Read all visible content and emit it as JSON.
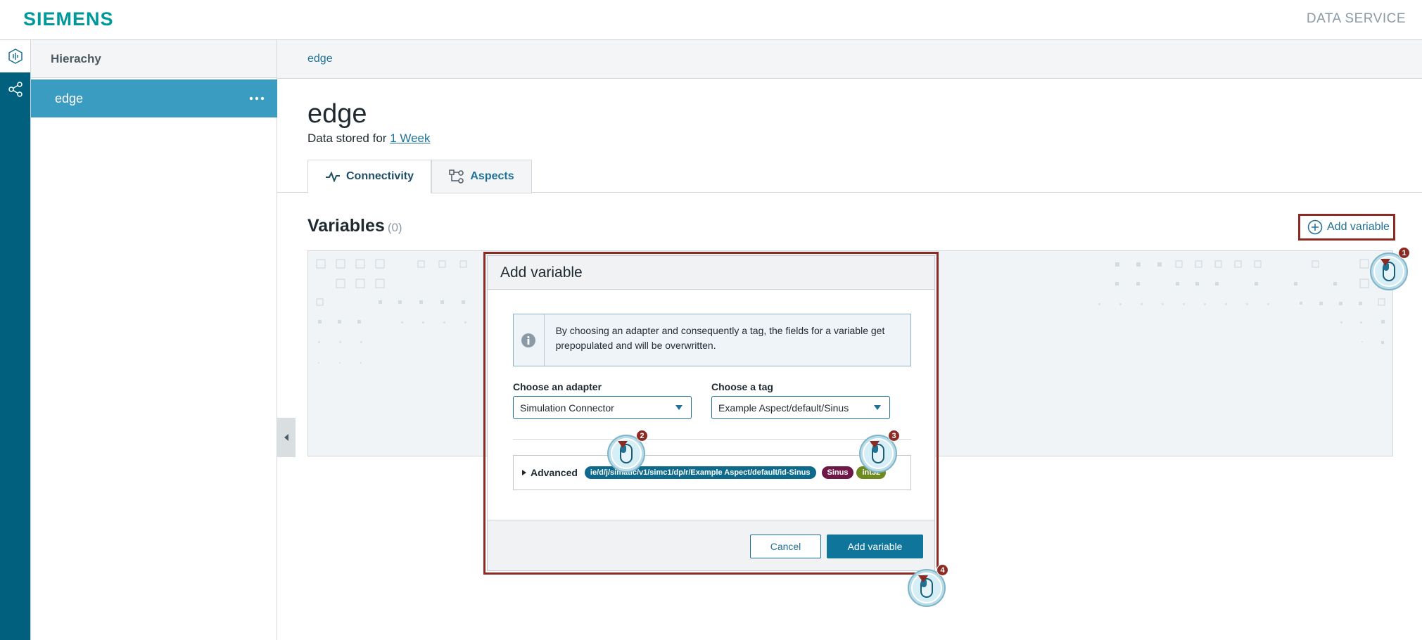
{
  "header": {
    "brand": "SIEMENS",
    "app_name": "DATA SERVICE"
  },
  "rail": {
    "items": [
      {
        "icon": "data-service-icon"
      },
      {
        "icon": "share-connections-icon"
      }
    ]
  },
  "hierarchy": {
    "title": "Hierachy",
    "items": [
      {
        "label": "edge",
        "menu": "..."
      }
    ]
  },
  "breadcrumb": {
    "current": "edge"
  },
  "asset": {
    "title": "edge",
    "retention_prefix": "Data stored for",
    "retention_link": "1 Week"
  },
  "tabs": [
    {
      "label": "Connectivity",
      "icon": "pulse-icon",
      "active": true
    },
    {
      "label": "Aspects",
      "icon": "aspects-icon",
      "active": false
    }
  ],
  "variables": {
    "title": "Variables",
    "count": "(0)",
    "add_label": "Add variable"
  },
  "modal": {
    "title": "Add variable",
    "info_text": "By choosing an adapter and consequently a tag, the fields for a variable get prepopulated and will be overwritten.",
    "adapter": {
      "label": "Choose an adapter",
      "value": "Simulation Connector"
    },
    "tag": {
      "label": "Choose a tag",
      "value": "Example Aspect/default/Sinus"
    },
    "advanced": {
      "label": "Advanced",
      "path": "ie/d/j/simatic/v1/simc1/dp/r/Example Aspect/default/id-Sinus",
      "name": "Sinus",
      "type": "int32"
    },
    "cancel_label": "Cancel",
    "submit_label": "Add variable"
  },
  "steps": [
    "1",
    "2",
    "3",
    "4"
  ],
  "colors": {
    "brand": "#009999",
    "rail": "#00607e",
    "selected": "#3a9cc1",
    "primary": "#10759a",
    "highlight": "#8b2b23",
    "pill_path": "#0d6a8c",
    "pill_name": "#6e1847",
    "pill_type": "#6d8a1e"
  }
}
